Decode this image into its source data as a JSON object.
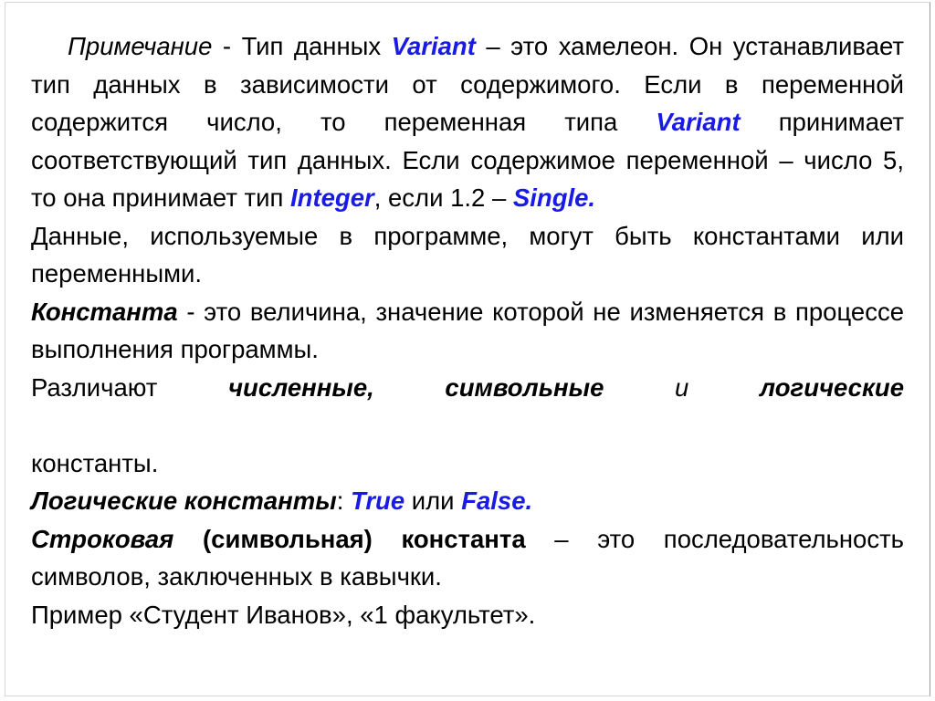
{
  "slide": {
    "accent_color": "#1a1ae6",
    "text_color": "#000000",
    "background_color": "#ffffff",
    "paragraphs": {
      "p1": {
        "note_label": "Примечание",
        "seg_dash": " - ",
        "seg_a": "Тип данных ",
        "kw_variant_1": "Variant",
        "seg_b": " – это хамелеон. Он устанавливает тип данных в зависимости от содержимого. Если в переменной содержится число,  то переменная типа ",
        "kw_variant_2": "Variant",
        "seg_c": " принимает соответствующий тип данных. Если содержимое переменной – число 5, то она принимает  тип ",
        "kw_integer": "Integer",
        "seg_d": ", если 1.2 – ",
        "kw_single": "Single.",
        "line1_fragment": "Примечание - Тип данных Variant – это хамелеон. Он",
        "line2_fragment": "устанавливает тип данных в зависимости от содержимого.",
        "line3_fragment": "Если в переменной содержится число,  то переменная типа",
        "line4_fragment": "Variant принимает соответствующий тип данных. Если",
        "line5_fragment": "содержимое переменной – число 5, то она принимает  тип",
        "line6_fragment": "Integer, если 1.2 – Single."
      },
      "p2": {
        "text": "Данные, используемые в программе, могут быть константами или переменными."
      },
      "p3": {
        "term": "Константа",
        "rest": " -  это величина, значение которой не изменяется в процессе выполнения программы."
      },
      "p4": {
        "lead": "Различают ",
        "b1": "численные, символьные",
        "mid": " и ",
        "b2": "логические",
        "tail": " константы."
      },
      "p5": {
        "term": "Логические константы",
        "colon": ": ",
        "kw_true": "True",
        "conj": " или ",
        "kw_false": "False."
      },
      "p6": {
        "term_italic": "Строковая",
        "term_bold": " (символьная) константа",
        "rest": " – это последовательность символов, заключенных в кавычки."
      },
      "p7": {
        "text": "Пример «Студент Иванов», «1 факультет»."
      }
    }
  }
}
